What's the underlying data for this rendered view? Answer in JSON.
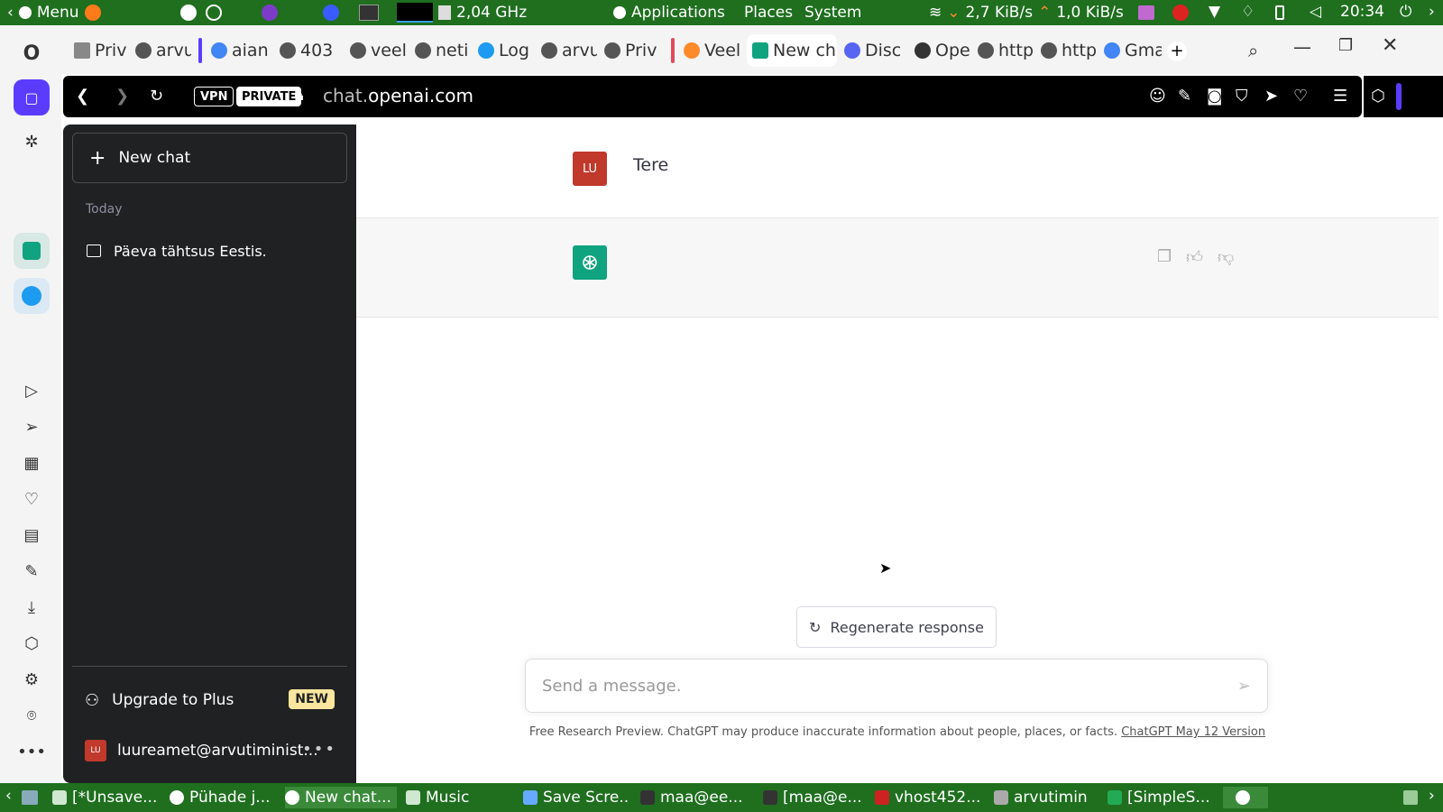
{
  "system_top": {
    "menu_label": "Menu",
    "cpu_freq": "2,04 GHz",
    "applications": "Applications",
    "places": "Places",
    "system": "System",
    "net_down": "2,7 KiB/s",
    "net_up": "1,0 KiB/s",
    "clock": "20:34"
  },
  "tabs": [
    {
      "label": "Priv"
    },
    {
      "label": "arvu"
    },
    {
      "label": "aian"
    },
    {
      "label": "403"
    },
    {
      "label": "veel"
    },
    {
      "label": "neti"
    },
    {
      "label": "Log"
    },
    {
      "label": "arvu"
    },
    {
      "label": "Priv"
    },
    {
      "label": "Veel"
    },
    {
      "label": "New cha"
    },
    {
      "label": "Disc"
    },
    {
      "label": "Ope"
    },
    {
      "label": "http"
    },
    {
      "label": "http"
    },
    {
      "label": "Gma"
    }
  ],
  "urlbar": {
    "vpn": "VPN",
    "private": "PRIVATE",
    "url_prefix": "chat.",
    "url_host": "openai.com"
  },
  "sidebar": {
    "new_chat": "New chat",
    "section_today": "Today",
    "conversations": [
      {
        "title": "Päeva tähtsus Eestis."
      }
    ],
    "upgrade": "Upgrade to Plus",
    "new_badge": "NEW",
    "account_initials": "LU",
    "account_email": "luureamet@arvutiminist..."
  },
  "chat": {
    "user_initials": "LU",
    "user_message": "Tere",
    "regenerate": "Regenerate response",
    "input_placeholder": "Send a message.",
    "footer_text": "Free Research Preview. ChatGPT may produce inaccurate information about people, places, or facts.",
    "footer_link": "ChatGPT May 12 Version"
  },
  "taskbar": [
    {
      "label": "[*Unsave..."
    },
    {
      "label": "Pühade j..."
    },
    {
      "label": "New chat..."
    },
    {
      "label": "Music"
    },
    {
      "label": "Save Scre..."
    },
    {
      "label": "maa@ee..."
    },
    {
      "label": "[maa@e..."
    },
    {
      "label": "vhost452..."
    },
    {
      "label": "arvutimin"
    },
    {
      "label": "[SimpleS..."
    }
  ],
  "colors": {
    "panel_green": "#1f6f1f",
    "sidebar_bg": "#202123",
    "chatgpt_green": "#10a37f",
    "user_avatar": "#c0392b"
  }
}
